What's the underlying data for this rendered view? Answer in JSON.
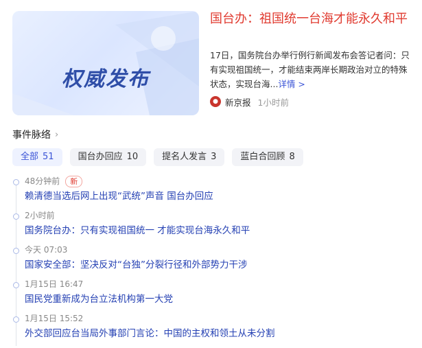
{
  "news": {
    "thumb_text": "权威发布",
    "headline": "国台办：祖国统一台海才能永久和平",
    "summary": "17日，国务院台办举行例行新闻发布会答记者问：只有实现祖国统一，才能结束两岸长期政治对立的特殊状态，实现台海...",
    "more_label": "详情 >",
    "source_name": "新京报",
    "source_time": "1小时前"
  },
  "events": {
    "title": "事件脉络",
    "filters": [
      {
        "label": "全部",
        "count": "51"
      },
      {
        "label": "国台办回应",
        "count": "10"
      },
      {
        "label": "提名人发言",
        "count": "3"
      },
      {
        "label": "蓝白合回顾",
        "count": "8"
      }
    ],
    "timeline": [
      {
        "time": "48分钟前",
        "badge": "新",
        "title": "赖清德当选后网上出现“武统”声音 国台办回应"
      },
      {
        "time": "2小时前",
        "title": "国务院台办：只有实现祖国统一 才能实现台海永久和平"
      },
      {
        "time": "今天 07:03",
        "title": "国家安全部：坚决反对“台独”分裂行径和外部势力干涉"
      },
      {
        "time": "1月15日 16:47",
        "title": "国民党重新成为台立法机构第一大党"
      },
      {
        "time": "1月15日 15:52",
        "title": "外交部回应台当局外事部门言论：中国的主权和领土从未分割"
      }
    ]
  },
  "colors": {
    "accent_red": "#e03a2f",
    "link_blue": "#2440b3"
  }
}
